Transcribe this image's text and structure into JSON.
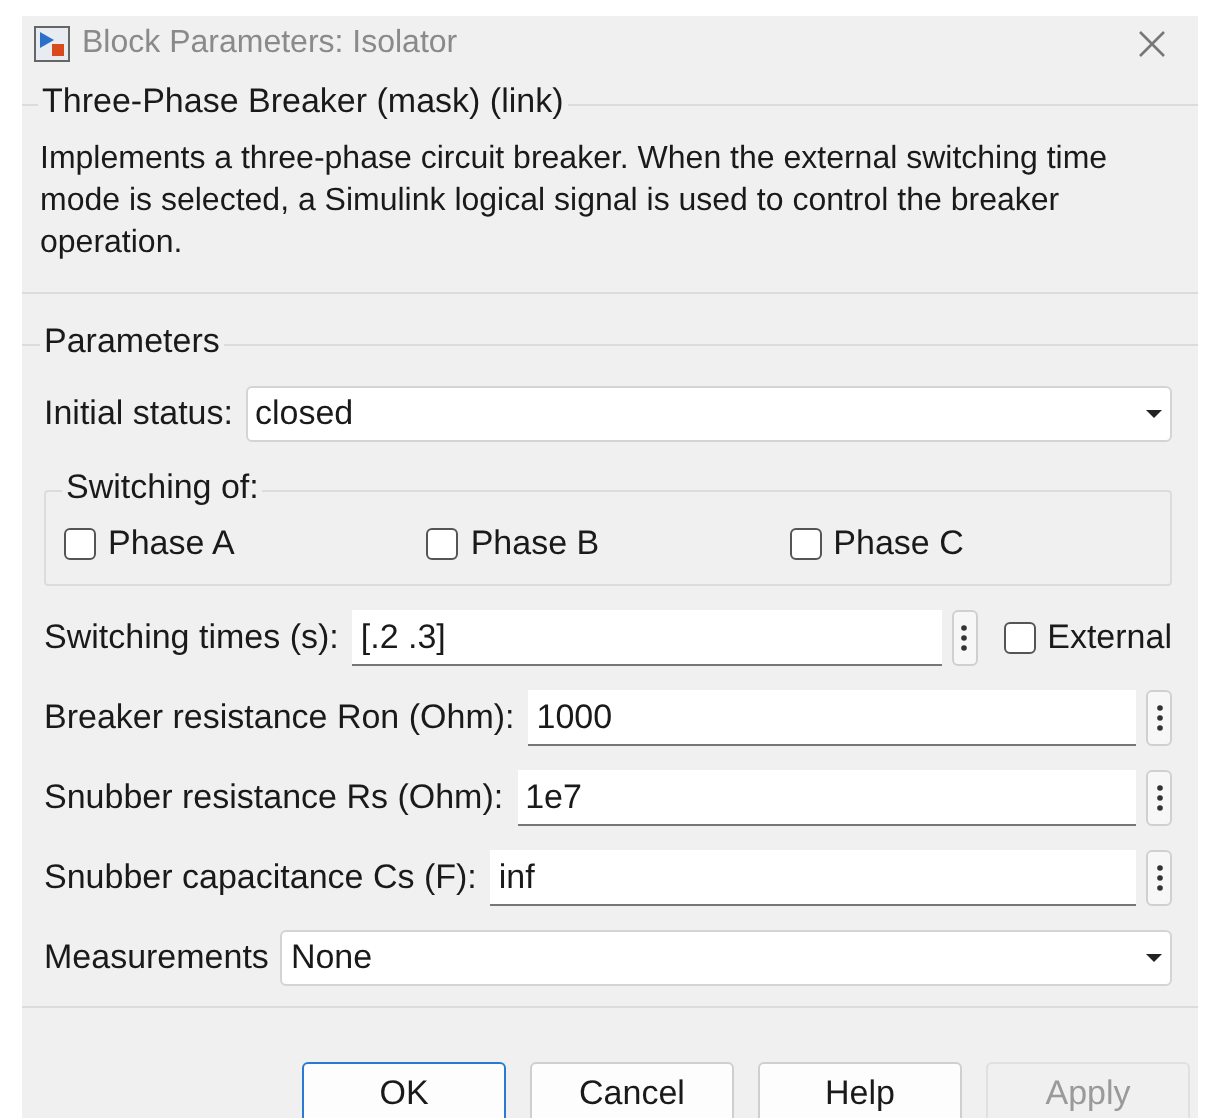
{
  "window": {
    "title": "Block Parameters: Isolator"
  },
  "description_group": {
    "title": "Three-Phase Breaker (mask) (link)",
    "text": "Implements a three-phase circuit breaker. When the external switching time mode is selected, a Simulink logical signal is used to control the breaker operation."
  },
  "parameters": {
    "title": "Parameters",
    "rows": [
      {
        "kind": "dropdown",
        "label": "Initial status:",
        "value": "closed"
      },
      {
        "kind": "group",
        "title": "Switching of:",
        "checkboxes": [
          {
            "label": "Phase A",
            "checked": false
          },
          {
            "label": "Phase B",
            "checked": false
          },
          {
            "label": "Phase C",
            "checked": false
          }
        ]
      },
      {
        "kind": "edit",
        "label": "Switching times (s):",
        "value": "[.2 .3]",
        "checkbox": {
          "label": "External",
          "checked": false
        }
      },
      {
        "kind": "edit",
        "label": "Breaker resistance Ron (Ohm):",
        "value": "1000"
      },
      {
        "kind": "edit",
        "label": "Snubber resistance Rs (Ohm):",
        "value": "1e7"
      },
      {
        "kind": "edit",
        "label": "Snubber capacitance Cs (F):",
        "value": "inf"
      },
      {
        "kind": "dropdown",
        "label": "Measurements",
        "value": "None"
      }
    ]
  },
  "buttons": [
    {
      "label": "OK",
      "default": true,
      "disabled": false
    },
    {
      "label": "Cancel",
      "default": false,
      "disabled": false
    },
    {
      "label": "Help",
      "default": false,
      "disabled": false
    },
    {
      "label": "Apply",
      "default": false,
      "disabled": true
    }
  ]
}
